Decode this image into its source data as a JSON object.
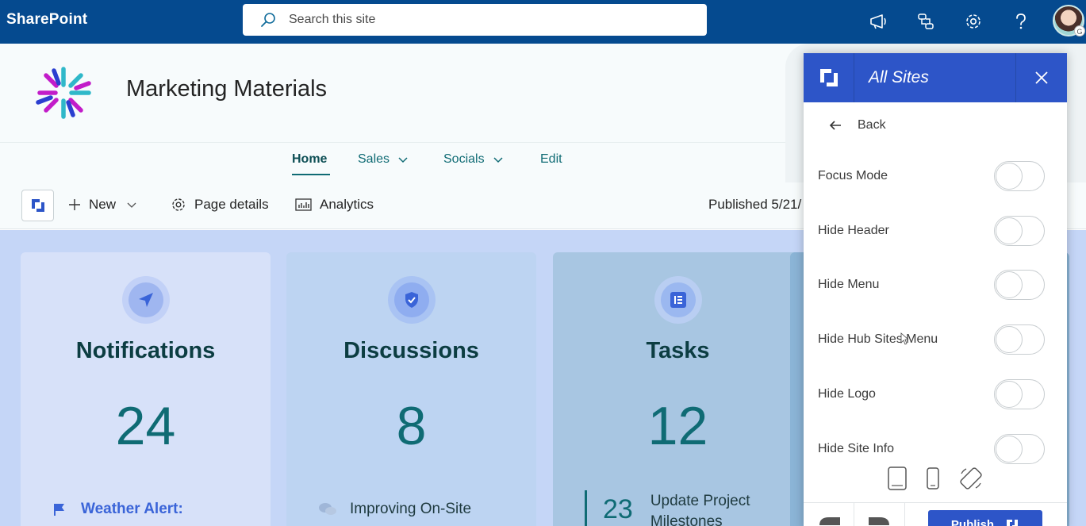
{
  "suite_bar": {
    "brand": "SharePoint",
    "search_placeholder": "Search this site",
    "icons": [
      "megaphone-icon",
      "connect-icon",
      "settings-icon",
      "help-icon"
    ],
    "avatar_badge": "G"
  },
  "site": {
    "title": "Marketing Materials"
  },
  "nav": {
    "items": [
      {
        "label": "Home",
        "active": true
      },
      {
        "label": "Sales",
        "has_dropdown": true
      },
      {
        "label": "Socials",
        "has_dropdown": true
      },
      {
        "label": "Edit"
      }
    ]
  },
  "command_bar": {
    "new_label": "New",
    "page_details_label": "Page details",
    "analytics_label": "Analytics",
    "published_text": "Published 5/21/"
  },
  "cards": [
    {
      "title": "Notifications",
      "count": "24",
      "item_text": "Weather Alert:",
      "icon": "send-icon"
    },
    {
      "title": "Discussions",
      "count": "8",
      "item_text": "Improving On-Site",
      "icon": "shield-icon"
    },
    {
      "title": "Tasks",
      "count": "12",
      "item_number": "23",
      "item_text_line1": "Update Project",
      "item_text_line2": "Milestones",
      "icon": "list-icon"
    }
  ],
  "panel": {
    "title": "All Sites",
    "back_label": "Back",
    "toggles": [
      {
        "label": "Focus Mode",
        "on": false
      },
      {
        "label": "Hide Header",
        "on": false
      },
      {
        "label": "Hide Menu",
        "on": false
      },
      {
        "label": "Hide Hub Sites Menu",
        "on": false
      },
      {
        "label": "Hide Logo",
        "on": false
      },
      {
        "label": "Hide Site Info",
        "on": false
      }
    ],
    "device_icons": [
      "tablet-icon",
      "phone-icon",
      "rotate-icon"
    ],
    "publish_label": "Publish"
  },
  "colors": {
    "suite_bar": "#054a8f",
    "accent_teal": "#0f6b74",
    "panel_blue": "#2d55c8",
    "content_bg": "#c5d6f7"
  }
}
